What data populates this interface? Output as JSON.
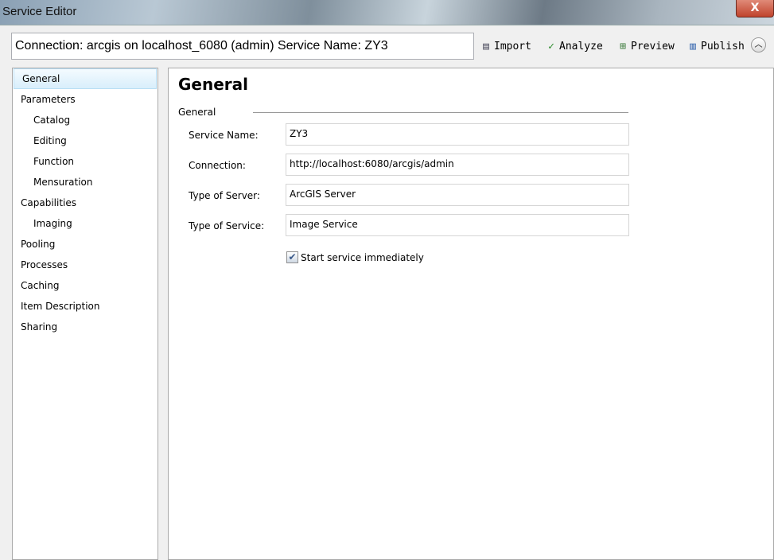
{
  "window": {
    "title": "Service Editor",
    "close_label": "X"
  },
  "header": {
    "connection_text": "Connection: arcgis on localhost_6080 (admin)   Service Name: ZY3"
  },
  "toolbar": {
    "import": "Import",
    "analyze": "Analyze",
    "preview": "Preview",
    "publish": "Publish"
  },
  "sidebar": {
    "items": [
      {
        "label": "General",
        "sub": false,
        "selected": true
      },
      {
        "label": "Parameters",
        "sub": false
      },
      {
        "label": "Catalog",
        "sub": true
      },
      {
        "label": "Editing",
        "sub": true
      },
      {
        "label": "Function",
        "sub": true
      },
      {
        "label": "Mensuration",
        "sub": true
      },
      {
        "label": "Capabilities",
        "sub": false
      },
      {
        "label": "Imaging",
        "sub": true
      },
      {
        "label": "Pooling",
        "sub": false
      },
      {
        "label": "Processes",
        "sub": false
      },
      {
        "label": "Caching",
        "sub": false
      },
      {
        "label": "Item Description",
        "sub": false
      },
      {
        "label": "Sharing",
        "sub": false
      }
    ]
  },
  "main": {
    "heading": "General",
    "group": "General",
    "fields": [
      {
        "label": "Service Name:",
        "value": "ZY3"
      },
      {
        "label": "Connection:",
        "value": "http://localhost:6080/arcgis/admin"
      },
      {
        "label": "Type of Server:",
        "value": "ArcGIS Server"
      },
      {
        "label": "Type of Service:",
        "value": "Image Service"
      }
    ],
    "start_checkbox": {
      "label": "Start service immediately",
      "checked": true
    }
  }
}
